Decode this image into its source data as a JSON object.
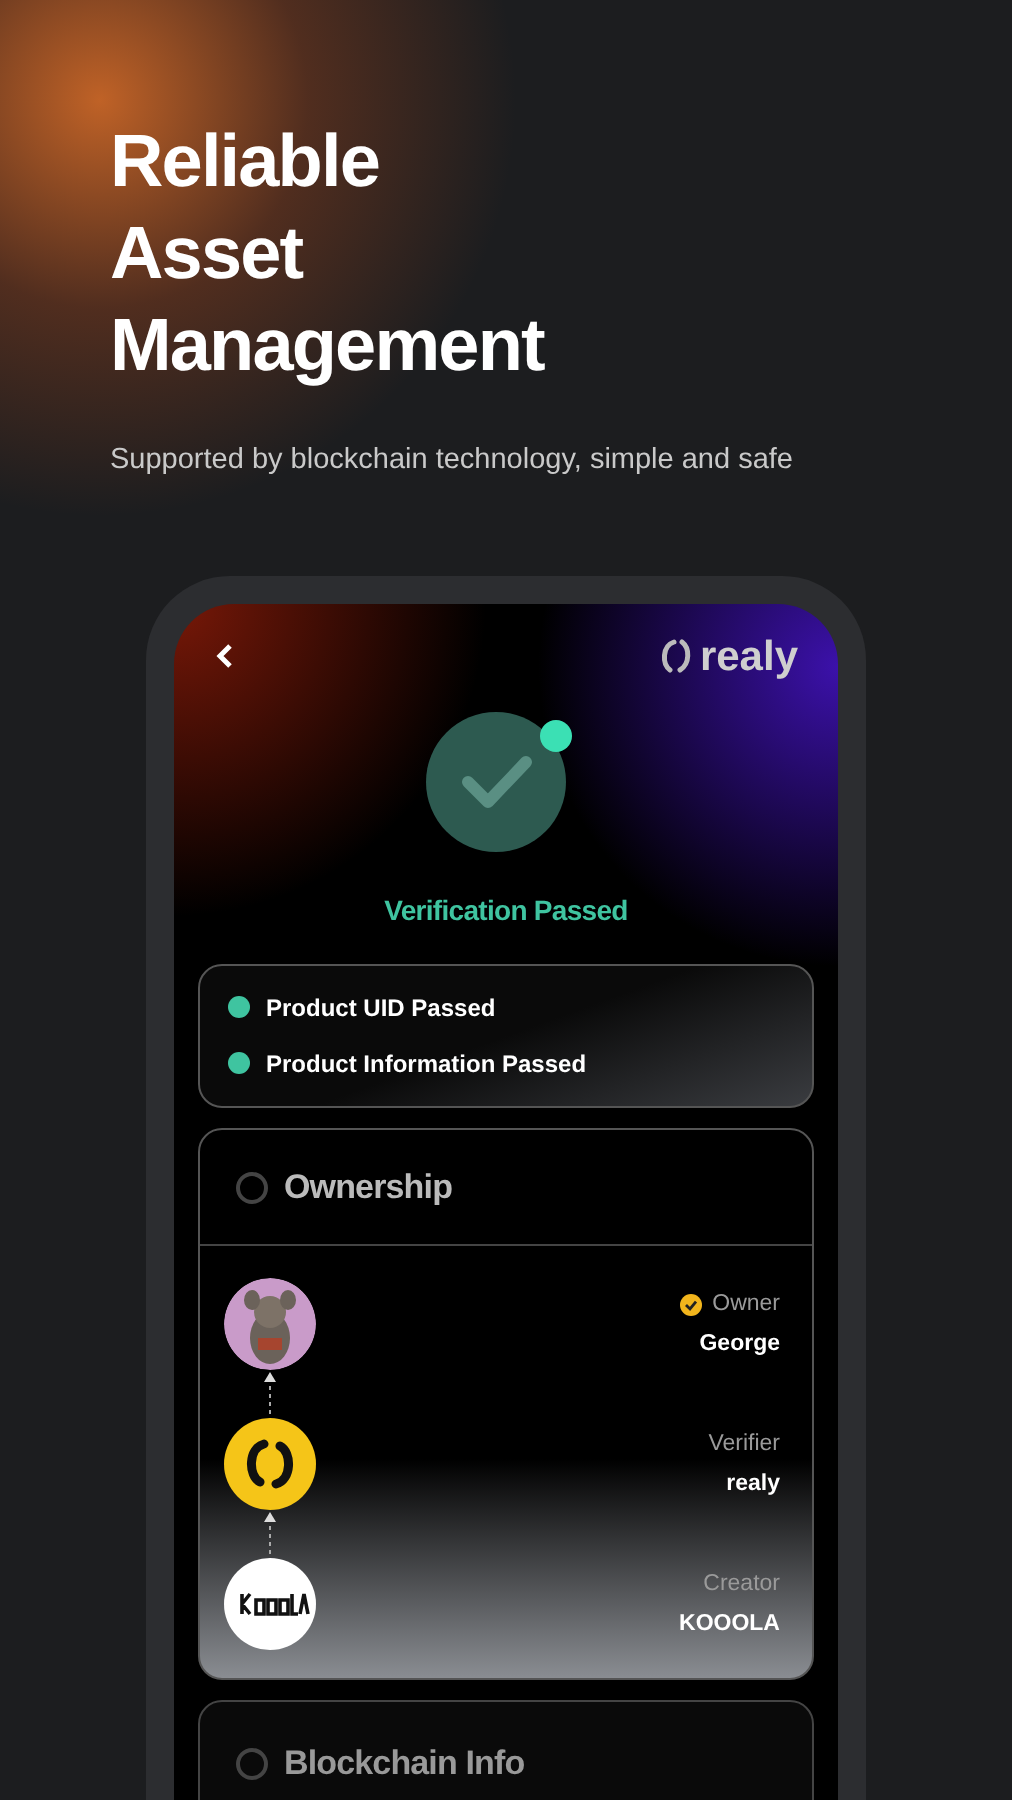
{
  "headline_lines": [
    "Reliable",
    "Asset",
    "Management"
  ],
  "subtitle": "Supported by blockchain technology, simple and safe",
  "app": {
    "brand": "realy",
    "status": "Verification Passed",
    "checks": [
      {
        "label": "Product UID Passed",
        "checked": true
      },
      {
        "label": "Product Information Passed",
        "checked": true
      }
    ],
    "ownership": {
      "title": "Ownership",
      "chain": [
        {
          "kind": "avatar",
          "role": "Owner",
          "name": "George",
          "verified": true
        },
        {
          "kind": "verifier",
          "role": "Verifier",
          "name": "realy",
          "verified": false
        },
        {
          "kind": "creator",
          "role": "Creator",
          "name": "KOOOLA",
          "verified": false
        }
      ]
    },
    "blockchain": {
      "title": "Blockchain Info"
    }
  }
}
